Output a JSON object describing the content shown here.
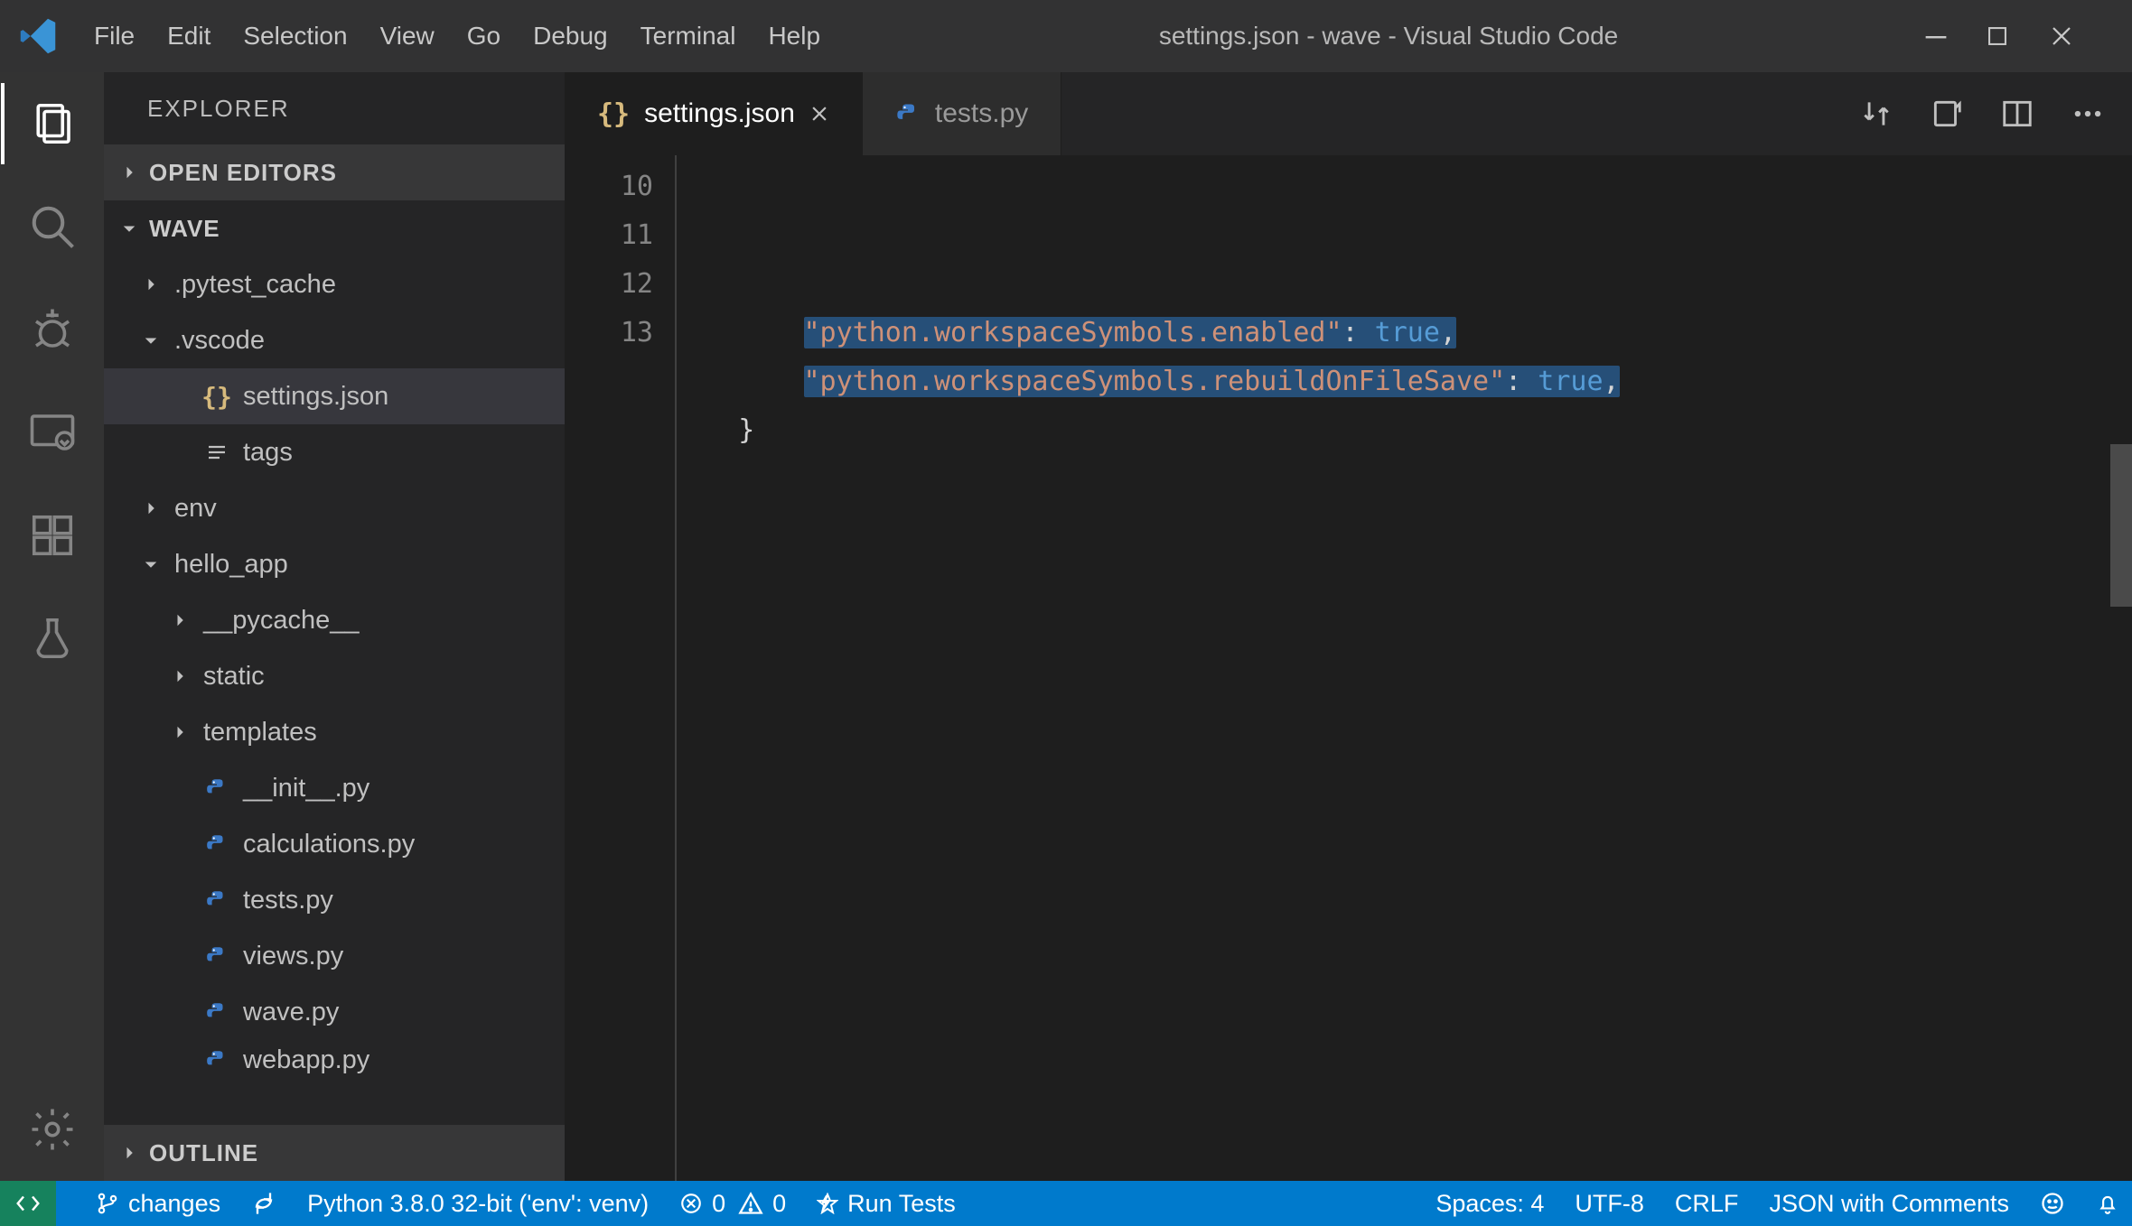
{
  "titlebar": {
    "menus": [
      "File",
      "Edit",
      "Selection",
      "View",
      "Go",
      "Debug",
      "Terminal",
      "Help"
    ],
    "title": "settings.json - wave - Visual Studio Code"
  },
  "sidebar": {
    "header": "EXPLORER",
    "open_editors": "OPEN EDITORS",
    "project": "WAVE",
    "outline": "OUTLINE",
    "tree": [
      {
        "type": "folder",
        "label": ".pytest_cache",
        "open": false,
        "depth": 1
      },
      {
        "type": "folder",
        "label": ".vscode",
        "open": true,
        "depth": 1
      },
      {
        "type": "file",
        "label": "settings.json",
        "icon": "json",
        "depth": 2,
        "selected": true
      },
      {
        "type": "file",
        "label": "tags",
        "icon": "lines",
        "depth": 2
      },
      {
        "type": "folder",
        "label": "env",
        "open": false,
        "depth": 1
      },
      {
        "type": "folder",
        "label": "hello_app",
        "open": true,
        "depth": 1
      },
      {
        "type": "folder",
        "label": "__pycache__",
        "open": false,
        "depth": 2
      },
      {
        "type": "folder",
        "label": "static",
        "open": false,
        "depth": 2
      },
      {
        "type": "folder",
        "label": "templates",
        "open": false,
        "depth": 2
      },
      {
        "type": "file",
        "label": "__init__.py",
        "icon": "py",
        "depth": 2
      },
      {
        "type": "file",
        "label": "calculations.py",
        "icon": "py",
        "depth": 2
      },
      {
        "type": "file",
        "label": "tests.py",
        "icon": "py",
        "depth": 2
      },
      {
        "type": "file",
        "label": "views.py",
        "icon": "py",
        "depth": 2
      },
      {
        "type": "file",
        "label": "wave.py",
        "icon": "py",
        "depth": 2
      },
      {
        "type": "file",
        "label": "webapp.py",
        "icon": "py",
        "depth": 2,
        "truncated": true
      }
    ]
  },
  "tabs": [
    {
      "label": "settings.json",
      "icon": "json",
      "active": true
    },
    {
      "label": "tests.py",
      "icon": "py",
      "active": false
    }
  ],
  "editor": {
    "lines": [
      {
        "num": "10",
        "indent": "        ",
        "tokens": [
          {
            "t": "str",
            "v": "\"python.workspaceSymbols.enabled\""
          },
          {
            "t": "punc",
            "v": ": "
          },
          {
            "t": "bool",
            "v": "true"
          },
          {
            "t": "punc",
            "v": ","
          }
        ],
        "sel": true
      },
      {
        "num": "11",
        "indent": "        ",
        "tokens": [
          {
            "t": "str",
            "v": "\"python.workspaceSymbols.rebuildOnFileSave\""
          },
          {
            "t": "punc",
            "v": ": "
          },
          {
            "t": "bool",
            "v": "true"
          },
          {
            "t": "punc",
            "v": ","
          }
        ],
        "sel": true
      },
      {
        "num": "12",
        "indent": "    ",
        "tokens": [
          {
            "t": "punc",
            "v": "}"
          }
        ]
      },
      {
        "num": "13",
        "indent": "",
        "tokens": []
      }
    ]
  },
  "status": {
    "branch": "changes",
    "python": "Python 3.8.0 32-bit ('env': venv)",
    "errors": "0",
    "warnings": "0",
    "runTests": "Run Tests",
    "spaces": "Spaces: 4",
    "encoding": "UTF-8",
    "eol": "CRLF",
    "lang": "JSON with Comments"
  }
}
